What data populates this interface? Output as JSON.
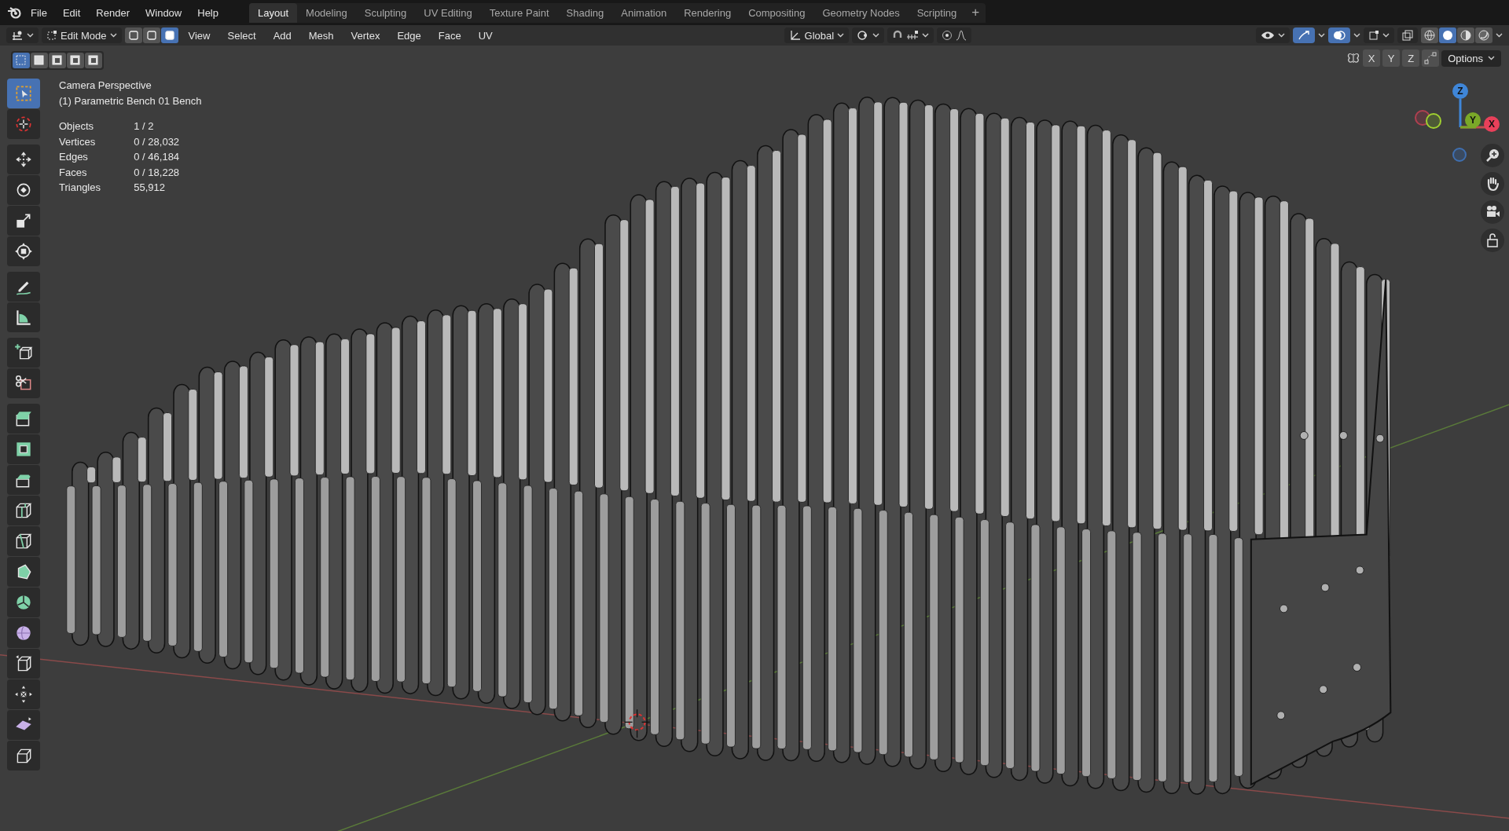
{
  "app_menu": [
    "File",
    "Edit",
    "Render",
    "Window",
    "Help"
  ],
  "workspaces": [
    {
      "label": "Layout",
      "selected": true
    },
    {
      "label": "Modeling",
      "selected": false
    },
    {
      "label": "Sculpting",
      "selected": false
    },
    {
      "label": "UV Editing",
      "selected": false
    },
    {
      "label": "Texture Paint",
      "selected": false
    },
    {
      "label": "Shading",
      "selected": false
    },
    {
      "label": "Animation",
      "selected": false
    },
    {
      "label": "Rendering",
      "selected": false
    },
    {
      "label": "Compositing",
      "selected": false
    },
    {
      "label": "Geometry Nodes",
      "selected": false
    },
    {
      "label": "Scripting",
      "selected": false
    }
  ],
  "add_workspace": "+",
  "editor_header": {
    "mode": "Edit Mode",
    "select_modes": [
      {
        "selected": false
      },
      {
        "selected": false
      },
      {
        "selected": true
      }
    ],
    "menus": [
      "View",
      "Select",
      "Add",
      "Mesh",
      "Vertex",
      "Edge",
      "Face",
      "UV"
    ],
    "orientation": "Global",
    "gizmos_on": true,
    "overlays_on": true,
    "xray": false,
    "shading": [
      {
        "selected": false
      },
      {
        "selected": true
      },
      {
        "selected": false
      },
      {
        "selected": false
      }
    ]
  },
  "tool_header": {
    "select_box_modes": [
      {
        "selected": true
      },
      {
        "selected": false
      },
      {
        "selected": false
      },
      {
        "selected": false
      },
      {
        "selected": false
      }
    ],
    "mirror_axes": [
      {
        "label": "X",
        "selected": false
      },
      {
        "label": "Y",
        "selected": false
      },
      {
        "label": "Z",
        "selected": false
      }
    ],
    "options": "Options"
  },
  "viewport": {
    "view_name": "Camera Perspective",
    "object_name": "(1) Parametric Bench 01 Bench",
    "stats": [
      {
        "label": "Objects",
        "value": "1 / 2"
      },
      {
        "label": "Vertices",
        "value": "0 / 28,032"
      },
      {
        "label": "Edges",
        "value": "0 / 46,184"
      },
      {
        "label": "Faces",
        "value": "0 / 18,228"
      },
      {
        "label": "Triangles",
        "value": "55,912"
      }
    ],
    "axes": [
      "X",
      "Y",
      "Z"
    ]
  },
  "toolbar": {
    "groups": [
      [
        {
          "selected": true
        },
        {
          "selected": false
        }
      ],
      [
        {
          "selected": false
        },
        {
          "selected": false
        },
        {
          "selected": false
        },
        {
          "selected": false
        }
      ],
      [
        {
          "selected": false
        },
        {
          "selected": false
        }
      ],
      [
        {
          "selected": false
        },
        {
          "selected": false
        }
      ],
      [
        {
          "selected": false
        },
        {
          "selected": false
        },
        {
          "selected": false
        },
        {
          "selected": false
        },
        {
          "selected": false
        },
        {
          "selected": false
        },
        {
          "selected": false
        },
        {
          "selected": false
        },
        {
          "selected": false
        },
        {
          "selected": false
        },
        {
          "selected": false
        },
        {
          "selected": false
        }
      ]
    ]
  }
}
